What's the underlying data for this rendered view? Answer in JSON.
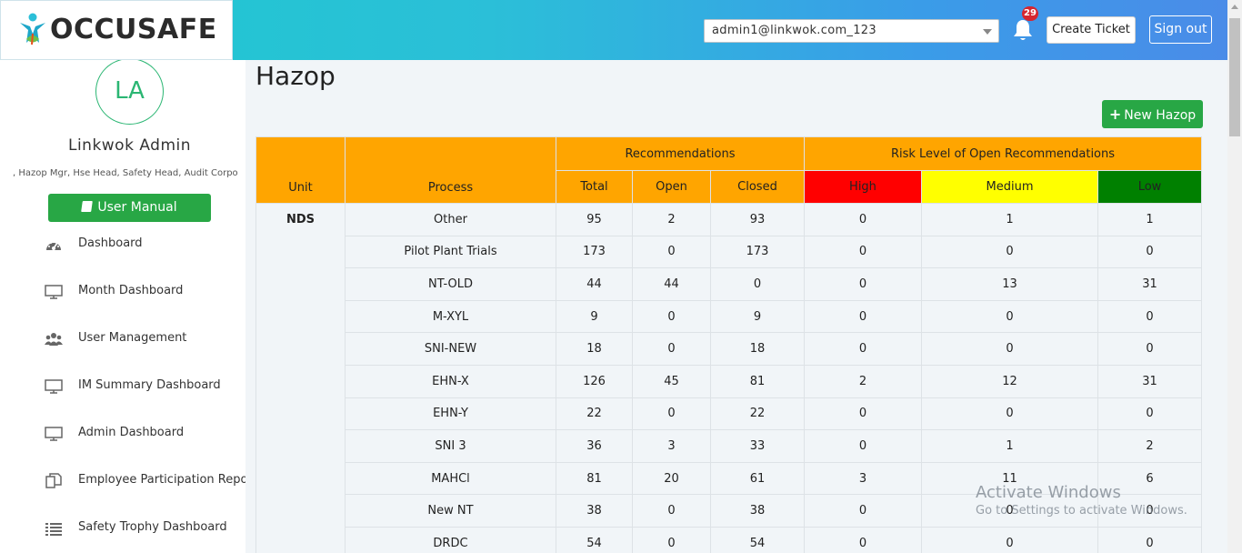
{
  "brand": {
    "name": "OCCUSAFE"
  },
  "header": {
    "account_select": "admin1@linkwok.com_123",
    "notification_count": "29",
    "create_ticket": "Create Ticket",
    "sign_out": "Sign out"
  },
  "sidebar": {
    "avatar_initials": "LA",
    "user_name": "Linkwok Admin",
    "user_roles": ", Hazop Mgr, Hse Head, Safety Head, Audit Corpo",
    "user_manual": "User Manual",
    "items": [
      {
        "label": "Dashboard",
        "icon": "gauge-icon"
      },
      {
        "label": "Month Dashboard",
        "icon": "monitor-icon"
      },
      {
        "label": "User Management",
        "icon": "users-icon"
      },
      {
        "label": "IM Summary Dashboard",
        "icon": "monitor-icon"
      },
      {
        "label": "Admin Dashboard",
        "icon": "monitor-icon"
      },
      {
        "label": "Employee Participation Report",
        "icon": "copy-icon"
      },
      {
        "label": "Safety Trophy Dashboard",
        "icon": "list-icon"
      }
    ]
  },
  "main": {
    "title": "Hazop",
    "new_button": "New Hazop",
    "table": {
      "headers": {
        "unit": "Unit",
        "process": "Process",
        "recommendations": "Recommendations",
        "risk_level": "Risk Level of Open Recommendations",
        "total": "Total",
        "open": "Open",
        "closed": "Closed",
        "high": "High",
        "medium": "Medium",
        "low": "Low"
      },
      "unit": "NDS",
      "rows": [
        {
          "process": "Other",
          "total": "95",
          "open": "2",
          "closed": "93",
          "high": "0",
          "medium": "1",
          "low": "1"
        },
        {
          "process": "Pilot Plant Trials",
          "total": "173",
          "open": "0",
          "closed": "173",
          "high": "0",
          "medium": "0",
          "low": "0"
        },
        {
          "process": "NT-OLD",
          "total": "44",
          "open": "44",
          "closed": "0",
          "high": "0",
          "medium": "13",
          "low": "31"
        },
        {
          "process": "M-XYL",
          "total": "9",
          "open": "0",
          "closed": "9",
          "high": "0",
          "medium": "0",
          "low": "0"
        },
        {
          "process": "SNI-NEW",
          "total": "18",
          "open": "0",
          "closed": "18",
          "high": "0",
          "medium": "0",
          "low": "0"
        },
        {
          "process": "EHN-X",
          "total": "126",
          "open": "45",
          "closed": "81",
          "high": "2",
          "medium": "12",
          "low": "31"
        },
        {
          "process": "EHN-Y",
          "total": "22",
          "open": "0",
          "closed": "22",
          "high": "0",
          "medium": "0",
          "low": "0"
        },
        {
          "process": "SNI 3",
          "total": "36",
          "open": "3",
          "closed": "33",
          "high": "0",
          "medium": "1",
          "low": "2"
        },
        {
          "process": "MAHCl",
          "total": "81",
          "open": "20",
          "closed": "61",
          "high": "3",
          "medium": "11",
          "low": "6"
        },
        {
          "process": "New NT",
          "total": "38",
          "open": "0",
          "closed": "38",
          "high": "0",
          "medium": "0",
          "low": "0"
        },
        {
          "process": "DRDC",
          "total": "54",
          "open": "0",
          "closed": "54",
          "high": "0",
          "medium": "0",
          "low": "0"
        }
      ]
    }
  },
  "watermark": {
    "line1": "Activate Windows",
    "line2": "Go to Settings to activate Windows."
  },
  "colors": {
    "header_orange": "#ffa500",
    "risk_high": "#ff0000",
    "risk_medium": "#ffff00",
    "risk_low": "#008000",
    "accent_green": "#28a745"
  }
}
